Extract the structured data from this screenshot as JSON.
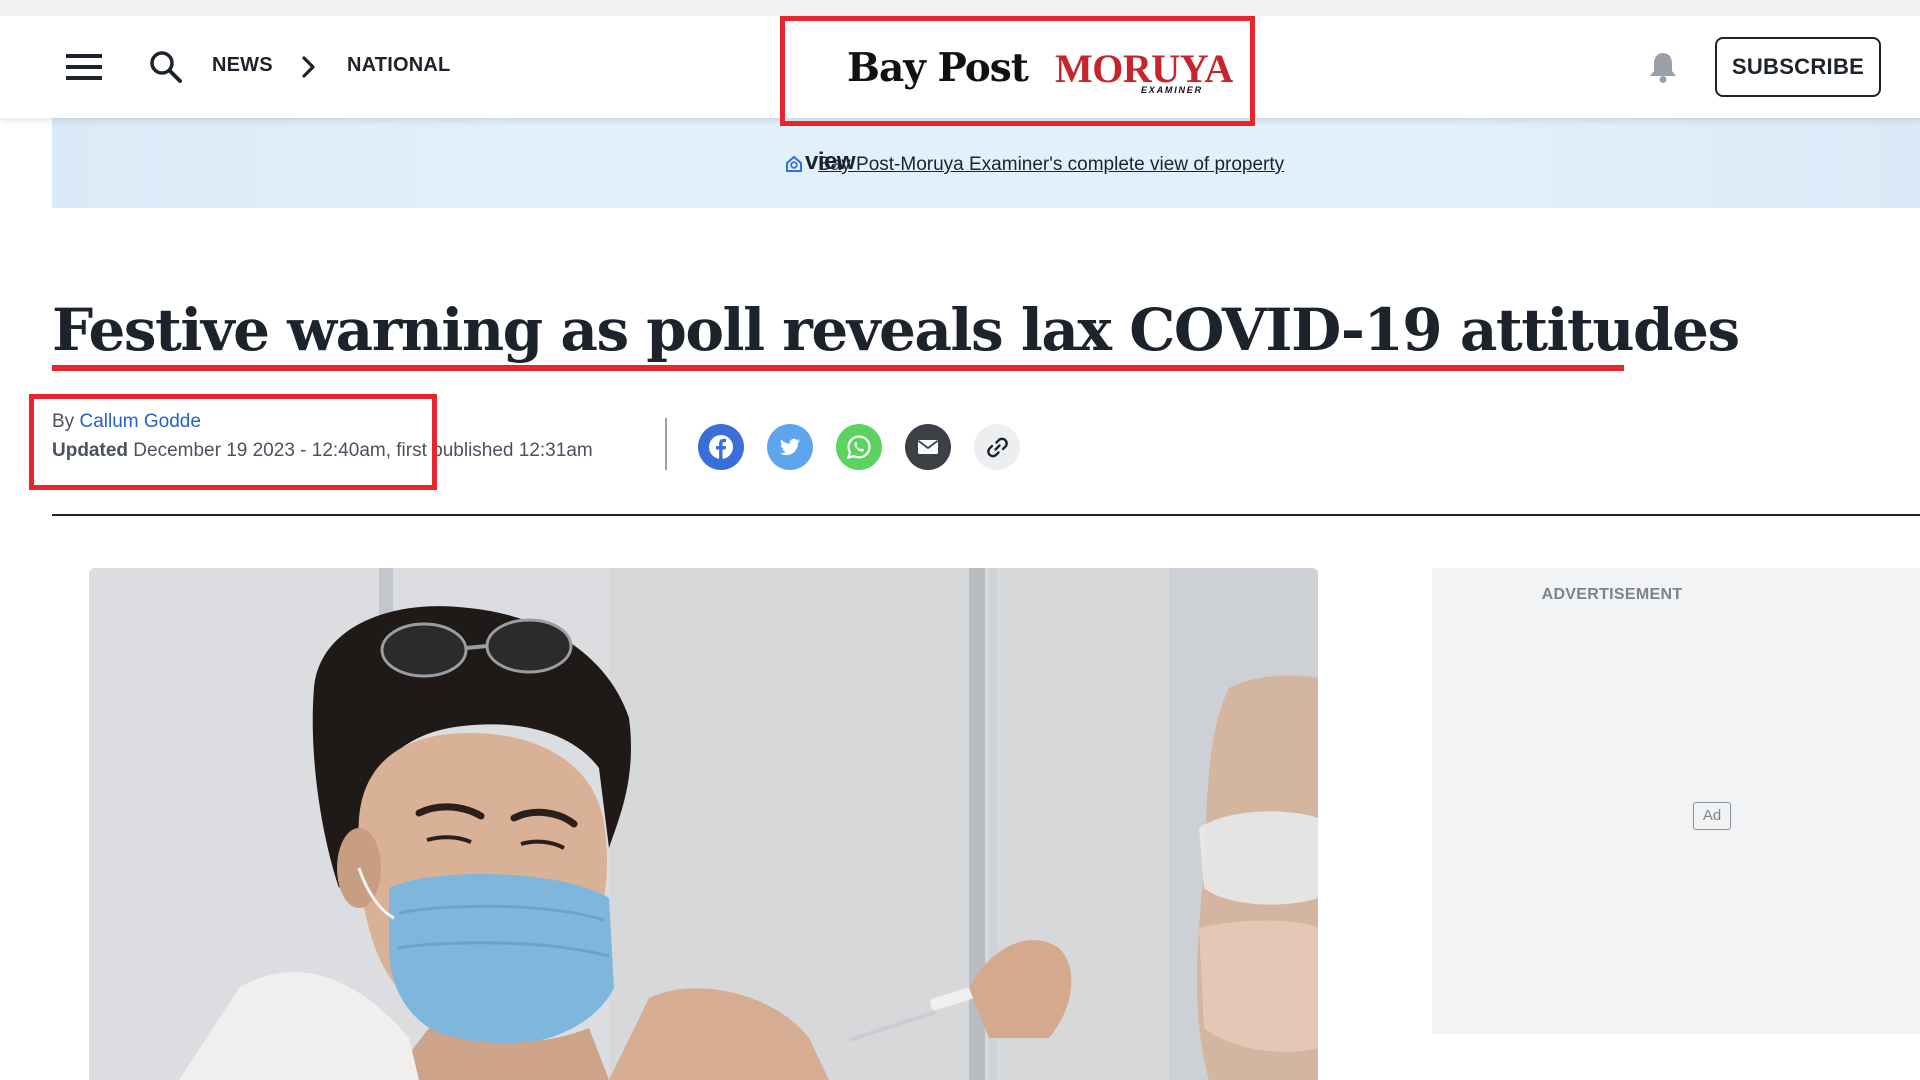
{
  "header": {
    "breadcrumb": {
      "section": "NEWS",
      "subsection": "NATIONAL"
    },
    "logo": {
      "primary": "Bay Post",
      "secondary": "MORUYA",
      "secondary_tag": "EXAMINER"
    },
    "subscribe_label": "SUBSCRIBE"
  },
  "banner": {
    "brand": "view",
    "link_text": "Bay Post-Moruya Examiner's complete view of property"
  },
  "article": {
    "headline": "Festive warning as poll reveals lax COVID-19 attitudes",
    "byline_prefix": "By",
    "author": "Callum Godde",
    "updated_label": "Updated",
    "updated_text": "December 19 2023 - 12:40am, first published 12:31am"
  },
  "share": {
    "icons": [
      "facebook-icon",
      "twitter-icon",
      "whatsapp-icon",
      "email-icon",
      "link-icon"
    ]
  },
  "sidebar": {
    "ad_label": "ADVERTISEMENT",
    "ad_badge": "Ad"
  },
  "colors": {
    "annotation_red": "#e8242c",
    "author_link": "#2461c8",
    "facebook": "#3b6fd8",
    "twitter": "#5fa5ee",
    "whatsapp": "#5dd35f",
    "email": "#3c4148",
    "banner_bg": "#e2f0fb"
  }
}
